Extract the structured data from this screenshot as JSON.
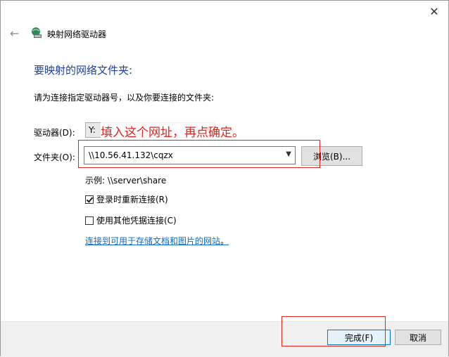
{
  "window": {
    "title": "映射网络驱动器",
    "close_glyph": "✕",
    "back_glyph": "←"
  },
  "main": {
    "heading": "要映射的网络文件夹:",
    "instruction": "请为连接指定驱动器号，以及你要连接的文件夹:",
    "drive": {
      "label": "驱动器(D):",
      "selected": "Y:"
    },
    "annotation": "填入这个网址，再点确定。",
    "folder": {
      "label": "文件夹(O):",
      "value": "\\\\10.56.41.132\\cqzx"
    },
    "browse_label": "浏览(B)...",
    "example": "示例: \\\\server\\share",
    "reconnect": {
      "label": "登录时重新连接(R)",
      "checked": true
    },
    "other_credentials": {
      "label": "使用其他凭据连接(C)",
      "checked": false
    },
    "link_text": "连接到可用于存储文档和图片的网站",
    "link_suffix": "。"
  },
  "footer": {
    "finish_label": "完成(F)",
    "cancel_label": "取消"
  },
  "colors": {
    "heading": "#1f3f9c",
    "link": "#0b6bc5",
    "annotation": "#e0251f"
  }
}
